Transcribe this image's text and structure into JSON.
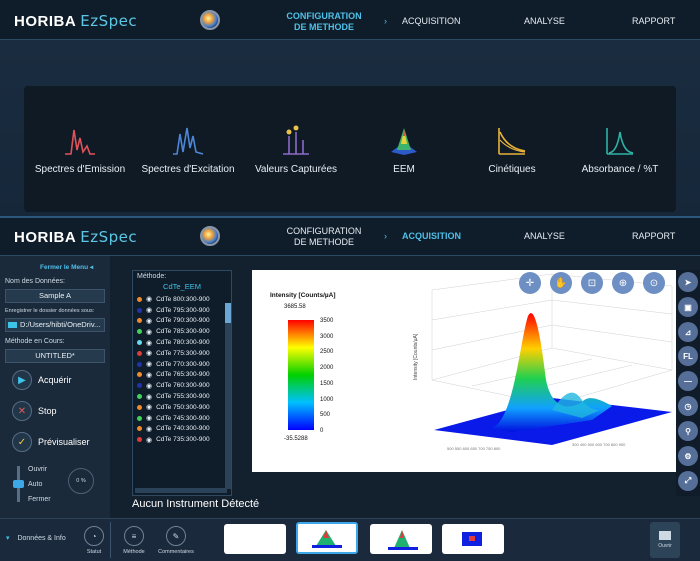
{
  "app": {
    "brand": "HORIBA",
    "product": "EzSpec"
  },
  "top_nav": {
    "config_line1": "CONFIGURATION",
    "config_line2": "DE METHODE",
    "acquisition": "ACQUISITION",
    "analyse": "ANALYSE",
    "rapport": "RAPPORT"
  },
  "modes": [
    {
      "label": "Spectres d'Emission",
      "icon": "emission-spectrum-icon",
      "color": "#e0525a"
    },
    {
      "label": "Spectres d'Excitation",
      "icon": "excitation-spectrum-icon",
      "color": "#4d86d6"
    },
    {
      "label": "Valeurs Capturées",
      "icon": "captured-values-icon",
      "color": "#8b6bc9"
    },
    {
      "label": "EEM",
      "icon": "eem-icon",
      "color": "#3eb36b"
    },
    {
      "label": "Cinétiques",
      "icon": "kinetics-icon",
      "color": "#e8b23a"
    },
    {
      "label": "Absorbance / %T",
      "icon": "absorbance-icon",
      "color": "#2fb3a6"
    }
  ],
  "left_panel": {
    "close_menu": "Fermer le Menu",
    "data_name_label": "Nom des Données:",
    "data_name_value": "Sample A",
    "save_folder_label": "Enregistrer le dossier données sous:",
    "save_folder_value": "D:/Users/hibti/OneDriv...",
    "method_label": "Méthode en Cours:",
    "method_value": "UNTITLED*",
    "acquire": "Acquérir",
    "stop": "Stop",
    "preview": "Prévisualiser",
    "shutter_open": "Ouvrir",
    "shutter_auto": "Auto",
    "shutter_close": "Fermer",
    "percent": "0 %"
  },
  "method_list": {
    "header": "Méthode:",
    "name": "CdTe_EEM",
    "rows": [
      {
        "label": "CdTe 800:300-900",
        "color": "#f08a2a"
      },
      {
        "label": "CdTe 795:300-900",
        "color": "#2233aa"
      },
      {
        "label": "CdTe 790:300-900",
        "color": "#f08a2a"
      },
      {
        "label": "CdTe 785:300-900",
        "color": "#3fd35a"
      },
      {
        "label": "CdTe 780:300-900",
        "color": "#6ad9ee"
      },
      {
        "label": "CdTe 775:300-900",
        "color": "#e03a3a"
      },
      {
        "label": "CdTe 770:300-900",
        "color": "#2233aa"
      },
      {
        "label": "CdTe 765:300-900",
        "color": "#f08a2a"
      },
      {
        "label": "CdTe 760:300-900",
        "color": "#2233aa"
      },
      {
        "label": "CdTe 755:300-900",
        "color": "#3fd35a"
      },
      {
        "label": "CdTe 750:300-900",
        "color": "#f08a2a"
      },
      {
        "label": "CdTe 745:300-900",
        "color": "#3fd35a"
      },
      {
        "label": "CdTe 740:300-900",
        "color": "#f08a2a"
      },
      {
        "label": "CdTe 735:300-900",
        "color": "#e03a3a"
      }
    ]
  },
  "plot": {
    "title": "Intensity [Counts/µA]",
    "max_value": "3685.58",
    "min_value": "-35.5288",
    "scale_ticks": [
      "3500",
      "3000",
      "2500",
      "2000",
      "1500",
      "1000",
      "500",
      "0"
    ],
    "z_axis_label": "Intensity [Counts/µA]"
  },
  "status": {
    "no_instrument": "Aucun Instrument Détecté"
  },
  "bottom": {
    "data_info": "Données & Info",
    "statut": "Statut",
    "methode": "Méthode",
    "commentaires": "Commentaires",
    "ouvrir": "Ouvrir"
  }
}
